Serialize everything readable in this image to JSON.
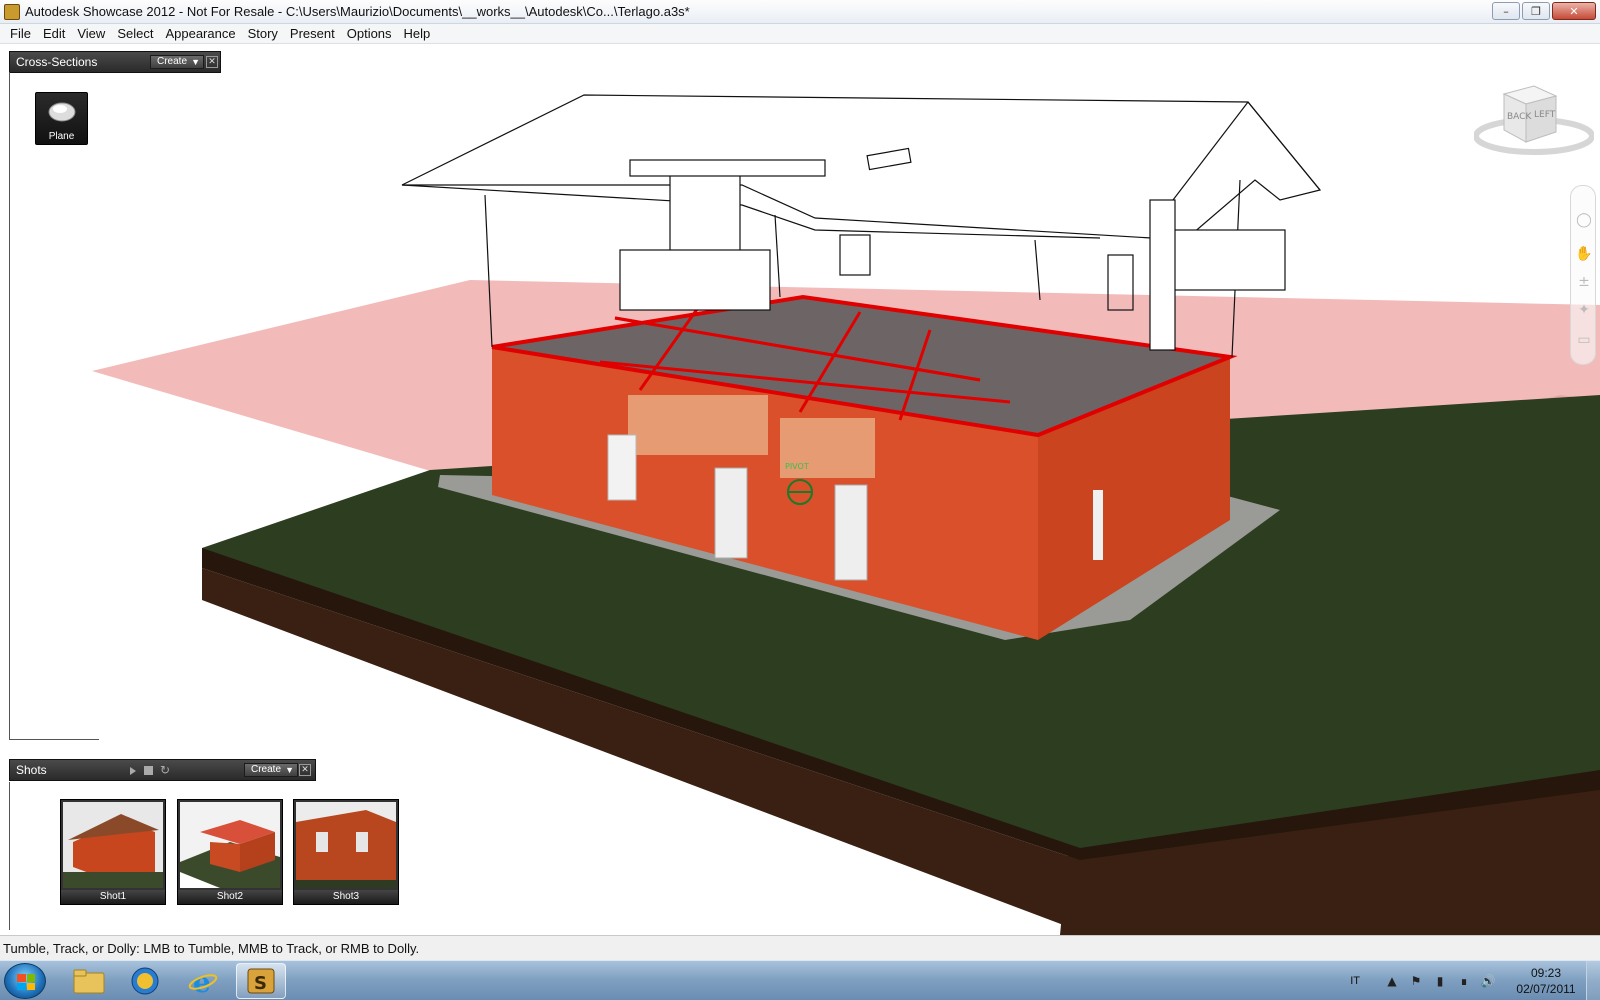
{
  "window": {
    "title": "Autodesk Showcase 2012 - Not For Resale - C:\\Users\\Maurizio\\Documents\\__works__\\Autodesk\\Co...\\Terlago.a3s*"
  },
  "menu": [
    "File",
    "Edit",
    "View",
    "Select",
    "Appearance",
    "Story",
    "Present",
    "Options",
    "Help"
  ],
  "cross_sections": {
    "title": "Cross-Sections",
    "create_label": "Create",
    "plane_label": "Plane"
  },
  "viewcube": {
    "back_label": "BACK",
    "left_label": "LEFT"
  },
  "scene": {
    "pivot_label": "PIVOT"
  },
  "shots": {
    "title": "Shots",
    "create_label": "Create",
    "items": [
      {
        "label": "Shot1"
      },
      {
        "label": "Shot2"
      },
      {
        "label": "Shot3"
      }
    ]
  },
  "status": {
    "text": "Tumble, Track, or Dolly: LMB to Tumble, MMB to Track, or RMB to Dolly."
  },
  "taskbar": {
    "language": "IT",
    "time": "09:23",
    "date": "02/07/2011"
  },
  "colors": {
    "wall": "#d9502a",
    "section_plane": "#f2b4b4",
    "section_line": "#e00000",
    "grass": "#2c3d20",
    "soil": "#3a2012"
  }
}
